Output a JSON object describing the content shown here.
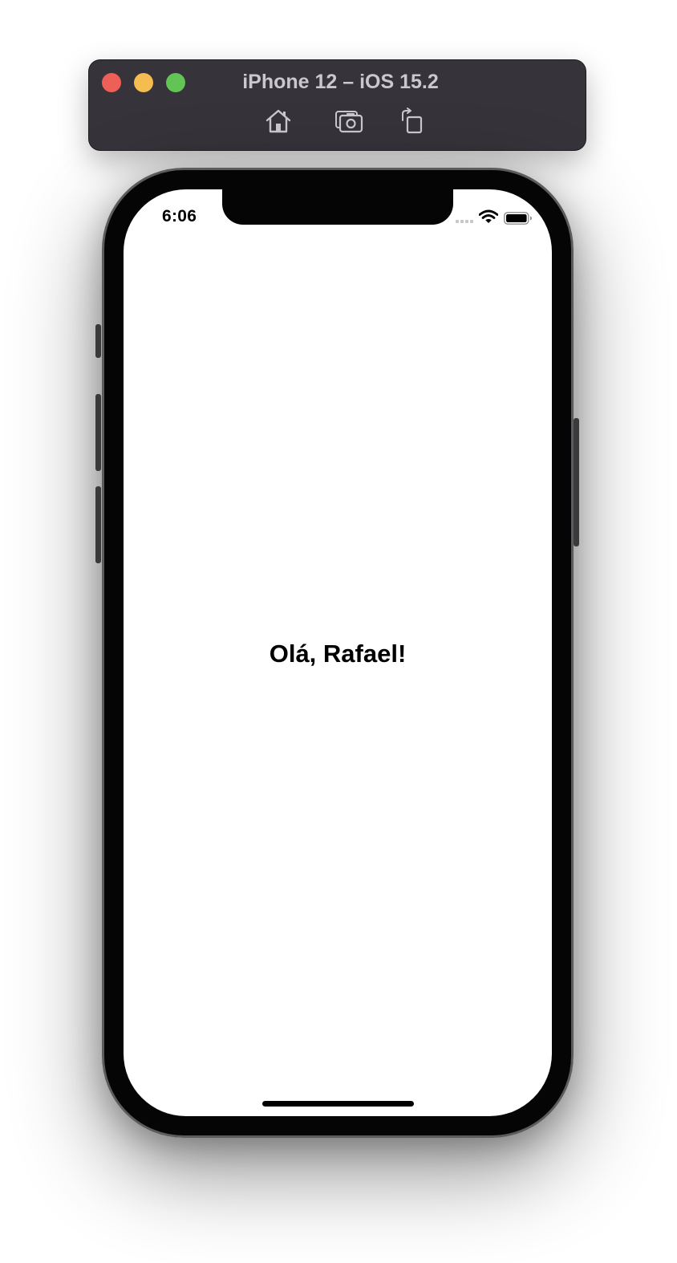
{
  "simulator": {
    "window_title": "iPhone 12 – iOS 15.2",
    "toolbar": {
      "home_icon": "home-icon",
      "screenshot_icon": "camera-icon",
      "rotate_icon": "rotate-icon"
    },
    "colors": {
      "titlebar": "#36343a",
      "close": "#ee5f57",
      "minimize": "#f5bd4f",
      "maximize": "#61c454"
    }
  },
  "status_bar": {
    "time": "6:06",
    "icons": [
      "cellular-signal-icon",
      "wifi-icon",
      "battery-icon"
    ]
  },
  "content": {
    "greeting": "Olá, Rafael!"
  }
}
